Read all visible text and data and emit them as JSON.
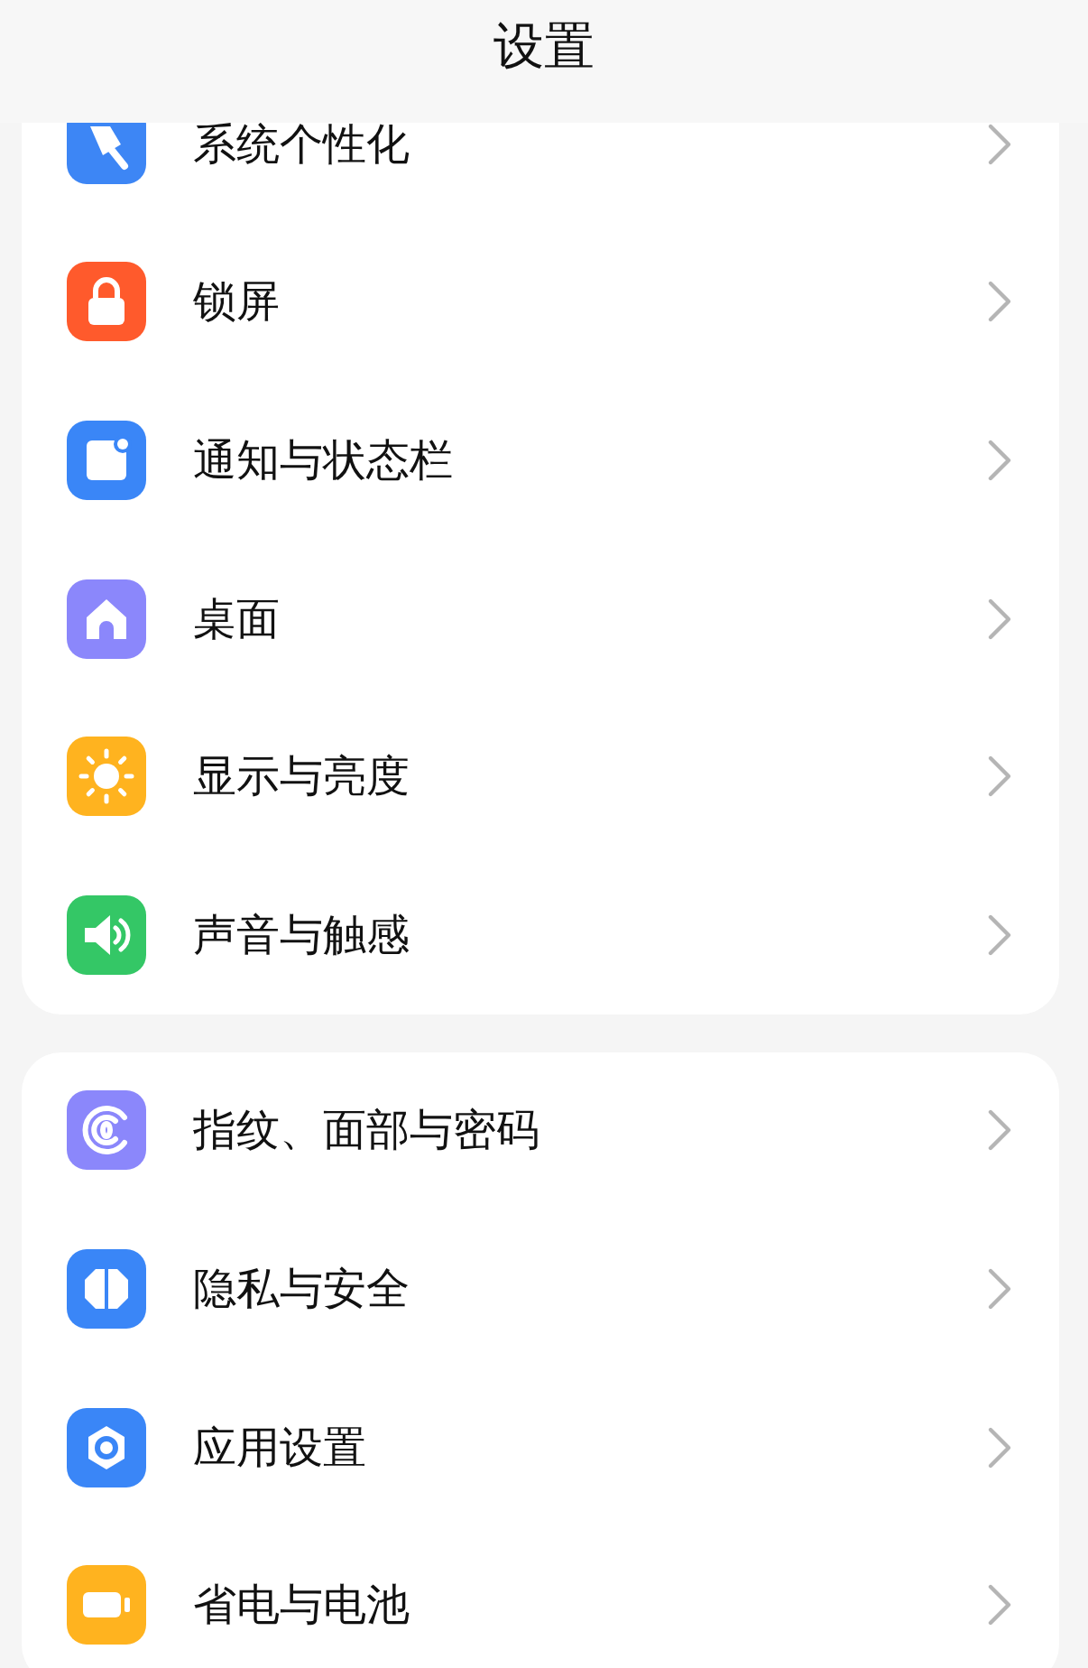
{
  "header": {
    "title": "设置"
  },
  "groups": [
    {
      "items": [
        {
          "kind": "brush",
          "label": "系统个性化"
        },
        {
          "kind": "lock",
          "label": "锁屏"
        },
        {
          "kind": "notification",
          "label": "通知与状态栏"
        },
        {
          "kind": "home",
          "label": "桌面"
        },
        {
          "kind": "sun",
          "label": "显示与亮度"
        },
        {
          "kind": "speaker",
          "label": "声音与触感"
        }
      ]
    },
    {
      "items": [
        {
          "kind": "fingerprint",
          "label": "指纹、面部与密码"
        },
        {
          "kind": "shield",
          "label": "隐私与安全"
        },
        {
          "kind": "hexagon",
          "label": "应用设置"
        },
        {
          "kind": "battery",
          "label": "省电与电池"
        }
      ]
    }
  ]
}
